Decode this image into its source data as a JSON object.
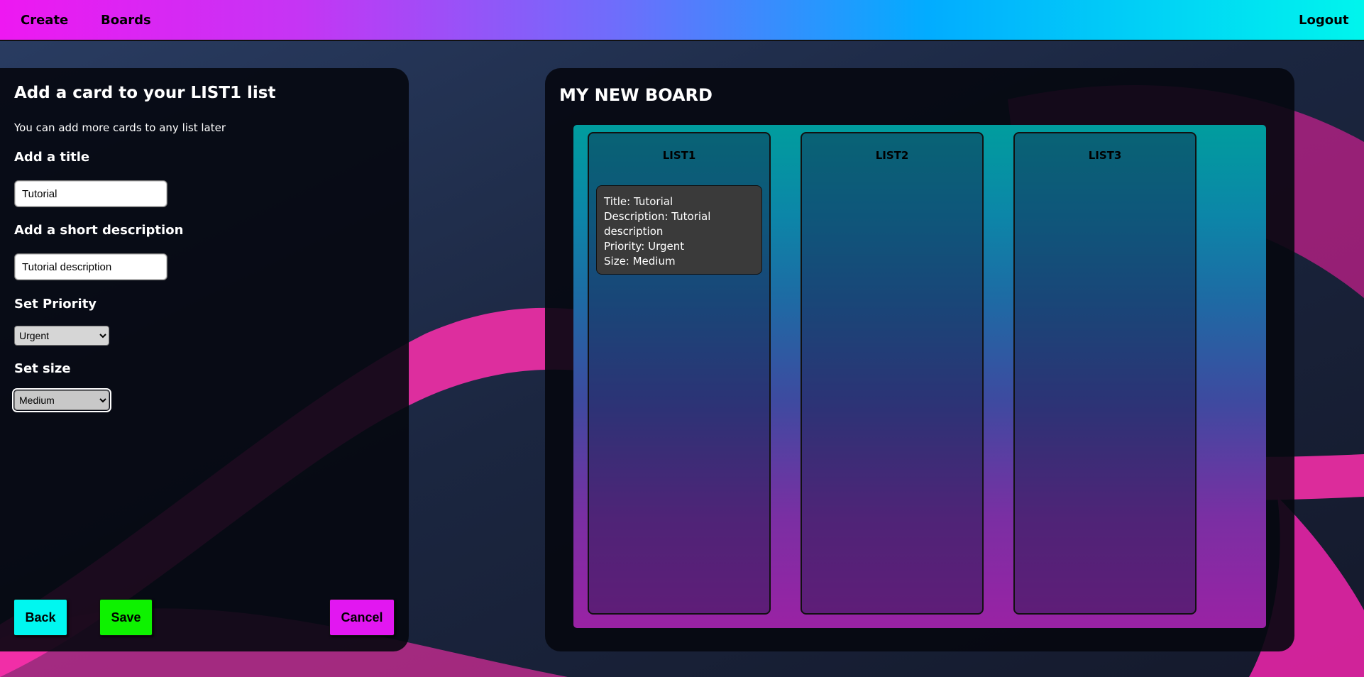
{
  "nav": {
    "create_label": "Create",
    "boards_label": "Boards",
    "logout_label": "Logout"
  },
  "form": {
    "heading": "Add a card to your LIST1 list",
    "subheading": "You can add more cards to any list later",
    "title_label": "Add a title",
    "title_value": "Tutorial",
    "description_label": "Add a short description",
    "description_value": "Tutorial description",
    "priority_label": "Set Priority",
    "priority_value": "Urgent",
    "size_label": "Set size",
    "size_value": "Medium",
    "back_label": "Back",
    "save_label": "Save",
    "cancel_label": "Cancel"
  },
  "board": {
    "title": "MY NEW BOARD",
    "lists": [
      {
        "title": "LIST1",
        "cards": [
          {
            "title_line": "Title: Tutorial",
            "description_line": "Description: Tutorial description",
            "priority_line": "Priority: Urgent",
            "size_line": "Size: Medium"
          }
        ]
      },
      {
        "title": "LIST2",
        "cards": []
      },
      {
        "title": "LIST3",
        "cards": []
      }
    ]
  },
  "colors": {
    "back_button": "#00f7f0",
    "save_button": "#0ef200",
    "cancel_button": "#e217f1",
    "panel": "#05080f",
    "card": "#3a3a3a"
  }
}
